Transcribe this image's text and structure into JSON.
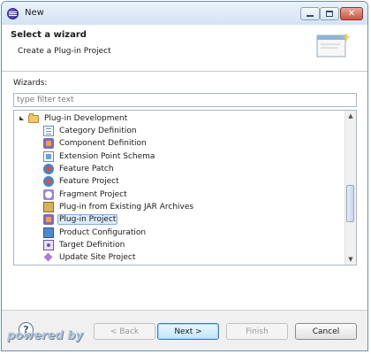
{
  "window": {
    "title": "New"
  },
  "banner": {
    "title": "Select a wizard",
    "description": "Create a Plug-in Project"
  },
  "wizards": {
    "label": "Wizards:",
    "filter_placeholder": "type filter text",
    "filter_value": ""
  },
  "tree": {
    "category": {
      "label": "Plug-in Development",
      "icon": "folder-open-icon",
      "expanded": true
    },
    "items": [
      {
        "label": "Category Definition",
        "icon": "category-definition-icon"
      },
      {
        "label": "Component Definition",
        "icon": "component-definition-icon"
      },
      {
        "label": "Extension Point Schema",
        "icon": "schema-icon"
      },
      {
        "label": "Feature Patch",
        "icon": "feature-patch-icon"
      },
      {
        "label": "Feature Project",
        "icon": "feature-project-icon"
      },
      {
        "label": "Fragment Project",
        "icon": "fragment-project-icon"
      },
      {
        "label": "Plug-in from Existing JAR Archives",
        "icon": "jar-icon"
      },
      {
        "label": "Plug-in Project",
        "icon": "plugin-project-icon",
        "selected": true
      },
      {
        "label": "Product Configuration",
        "icon": "product-configuration-icon"
      },
      {
        "label": "Target Definition",
        "icon": "target-definition-icon"
      },
      {
        "label": "Update Site Project",
        "icon": "update-site-icon"
      }
    ]
  },
  "buttons": {
    "back": "< Back",
    "next": "Next >",
    "finish": "Finish",
    "cancel": "Cancel"
  },
  "watermark": {
    "text": "powered by"
  }
}
